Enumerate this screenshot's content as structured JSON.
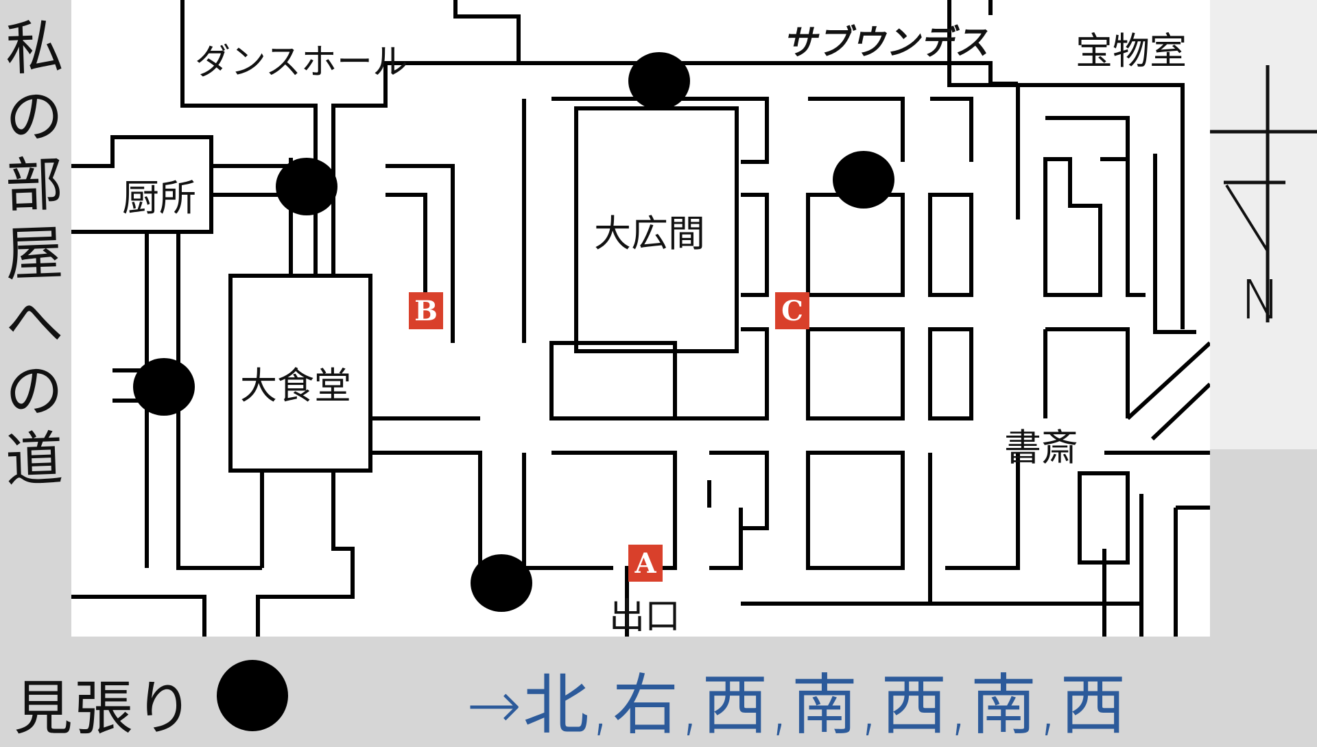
{
  "title_vertical": [
    "私",
    "の",
    "部",
    "屋",
    "へ",
    "の",
    "道"
  ],
  "rooms": {
    "dance_hall": "ダンスホール",
    "kitchen": "厨所",
    "great_hall": "大広間",
    "dining": "大食堂",
    "treasure": "宝物室",
    "study": "書斎",
    "exit": "出口",
    "sunroom": "サブウンデス"
  },
  "markers": {
    "a": "A",
    "b": "B",
    "c": "C"
  },
  "legend": {
    "watch_label": "見張り"
  },
  "route": "→北,右,西,南,西,南,西",
  "compass": {
    "mark": "N"
  },
  "colors": {
    "route": "#2c5a9a",
    "marker": "#d9402b",
    "guard": "#000000"
  }
}
